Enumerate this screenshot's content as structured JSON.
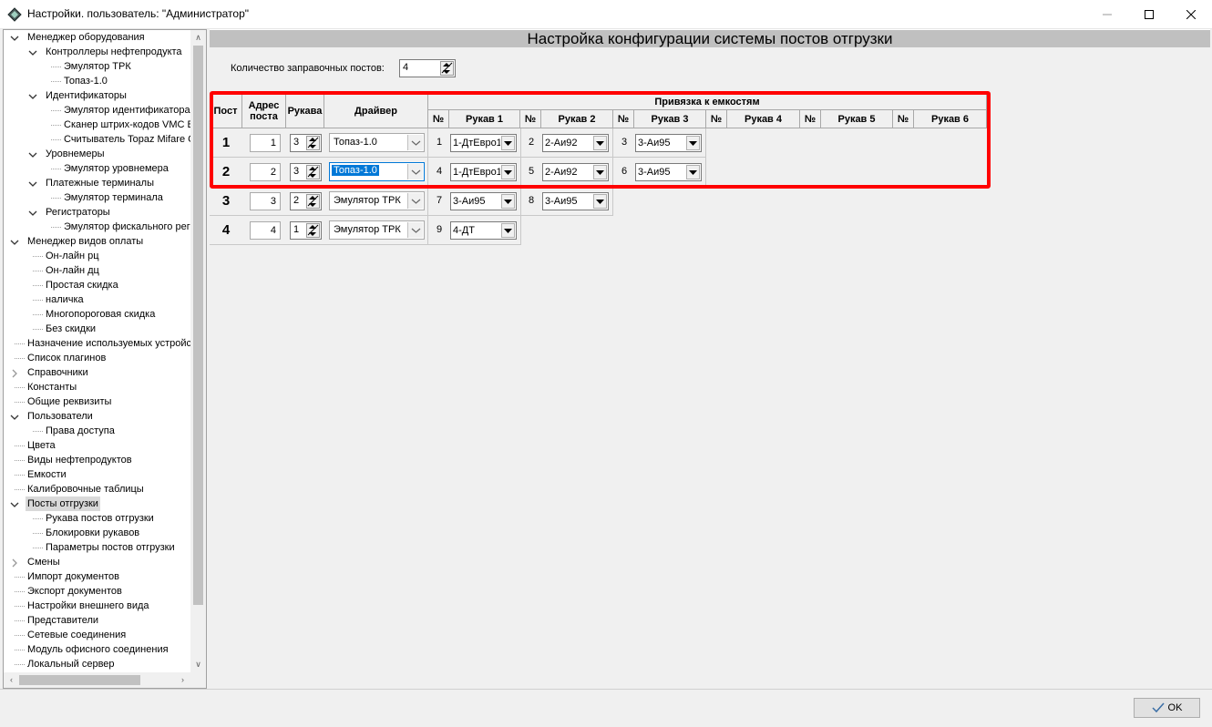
{
  "window": {
    "title": "Настройки. пользователь: \"Администратор\""
  },
  "tree": [
    {
      "label": "Менеджер оборудования",
      "level": 0,
      "expander": "open"
    },
    {
      "label": "Контроллеры нефтепродукта",
      "level": 1,
      "expander": "open"
    },
    {
      "label": "Эмулятор ТРК",
      "level": 2,
      "expander": "none"
    },
    {
      "label": "Топаз-1.0",
      "level": 2,
      "expander": "none"
    },
    {
      "label": "Идентификаторы",
      "level": 1,
      "expander": "open"
    },
    {
      "label": "Эмулятор идентификатора",
      "level": 2,
      "expander": "none"
    },
    {
      "label": "Сканер штрих-кодов VMC B",
      "level": 2,
      "expander": "none"
    },
    {
      "label": "Считыватель Topaz Mifare C",
      "level": 2,
      "expander": "none"
    },
    {
      "label": "Уровнемеры",
      "level": 1,
      "expander": "open"
    },
    {
      "label": "Эмулятор уровнемера",
      "level": 2,
      "expander": "none"
    },
    {
      "label": "Платежные терминалы",
      "level": 1,
      "expander": "open"
    },
    {
      "label": "Эмулятор терминала",
      "level": 2,
      "expander": "none"
    },
    {
      "label": "Регистраторы",
      "level": 1,
      "expander": "open"
    },
    {
      "label": "Эмулятор фискального реги",
      "level": 2,
      "expander": "none"
    },
    {
      "label": "Менеджер видов оплаты",
      "level": 0,
      "expander": "open"
    },
    {
      "label": "Он-лайн рц",
      "level": 1,
      "expander": "none"
    },
    {
      "label": "Он-лайн дц",
      "level": 1,
      "expander": "none"
    },
    {
      "label": "Простая скидка",
      "level": 1,
      "expander": "none"
    },
    {
      "label": "наличка",
      "level": 1,
      "expander": "none"
    },
    {
      "label": "Многопороговая скидка",
      "level": 1,
      "expander": "none"
    },
    {
      "label": "Без скидки",
      "level": 1,
      "expander": "none"
    },
    {
      "label": "Назначение используемых устройст",
      "level": 0,
      "expander": "none"
    },
    {
      "label": "Список плагинов",
      "level": 0,
      "expander": "none"
    },
    {
      "label": "Справочники",
      "level": 0,
      "expander": "closed"
    },
    {
      "label": "Константы",
      "level": 0,
      "expander": "none"
    },
    {
      "label": "Общие реквизиты",
      "level": 0,
      "expander": "none"
    },
    {
      "label": "Пользователи",
      "level": 0,
      "expander": "open"
    },
    {
      "label": "Права доступа",
      "level": 1,
      "expander": "none"
    },
    {
      "label": "Цвета",
      "level": 0,
      "expander": "none"
    },
    {
      "label": "Виды нефтепродуктов",
      "level": 0,
      "expander": "none"
    },
    {
      "label": "Емкости",
      "level": 0,
      "expander": "none"
    },
    {
      "label": "Калибровочные таблицы",
      "level": 0,
      "expander": "none"
    },
    {
      "label": "Посты отгрузки",
      "level": 0,
      "expander": "open",
      "selected": true
    },
    {
      "label": "Рукава постов отгрузки",
      "level": 1,
      "expander": "none"
    },
    {
      "label": "Блокировки рукавов",
      "level": 1,
      "expander": "none"
    },
    {
      "label": "Параметры постов отгрузки",
      "level": 1,
      "expander": "none"
    },
    {
      "label": "Смены",
      "level": 0,
      "expander": "closed"
    },
    {
      "label": "Импорт документов",
      "level": 0,
      "expander": "none"
    },
    {
      "label": "Экспорт документов",
      "level": 0,
      "expander": "none"
    },
    {
      "label": "Настройки внешнего вида",
      "level": 0,
      "expander": "none"
    },
    {
      "label": "Представители",
      "level": 0,
      "expander": "none"
    },
    {
      "label": "Сетевые соединения",
      "level": 0,
      "expander": "none"
    },
    {
      "label": "Модуль офисного соединения",
      "level": 0,
      "expander": "none"
    },
    {
      "label": "Локальный сервер",
      "level": 0,
      "expander": "none"
    }
  ],
  "main": {
    "header": "Настройка конфигурации системы постов отгрузки",
    "count_label": "Количество заправочных постов:",
    "count_value": "4",
    "columns": {
      "post": "Пост",
      "address": "Адрес поста",
      "hoses": "Рукава",
      "driver": "Драйвер",
      "binding": "Привязка к емкостям",
      "num": "№",
      "hose_labels": [
        "Рукав 1",
        "Рукав 2",
        "Рукав 3",
        "Рукав 4",
        "Рукав 5",
        "Рукав 6"
      ]
    },
    "posts": [
      {
        "post": "1",
        "address": "1",
        "hoses": "3",
        "driver": "Топаз-1.0",
        "driver_focused": false,
        "tanks": [
          {
            "num": "1",
            "tank": "1-ДтЕвро1"
          },
          {
            "num": "2",
            "tank": "2-Аи92"
          },
          {
            "num": "3",
            "tank": "3-Аи95"
          }
        ]
      },
      {
        "post": "2",
        "address": "2",
        "hoses": "3",
        "driver": "Топаз-1.0",
        "driver_focused": true,
        "tanks": [
          {
            "num": "4",
            "tank": "1-ДтЕвро1"
          },
          {
            "num": "5",
            "tank": "2-Аи92"
          },
          {
            "num": "6",
            "tank": "3-Аи95"
          }
        ]
      },
      {
        "post": "3",
        "address": "3",
        "hoses": "2",
        "driver": "Эмулятор ТРК",
        "driver_focused": false,
        "tanks": [
          {
            "num": "7",
            "tank": "3-Аи95"
          },
          {
            "num": "8",
            "tank": "3-Аи95"
          }
        ]
      },
      {
        "post": "4",
        "address": "4",
        "hoses": "1",
        "driver": "Эмулятор ТРК",
        "driver_focused": false,
        "tanks": [
          {
            "num": "9",
            "tank": "4-ДТ"
          }
        ]
      }
    ],
    "highlight_color": "#ff0000"
  },
  "footer": {
    "ok_label": "OK"
  }
}
